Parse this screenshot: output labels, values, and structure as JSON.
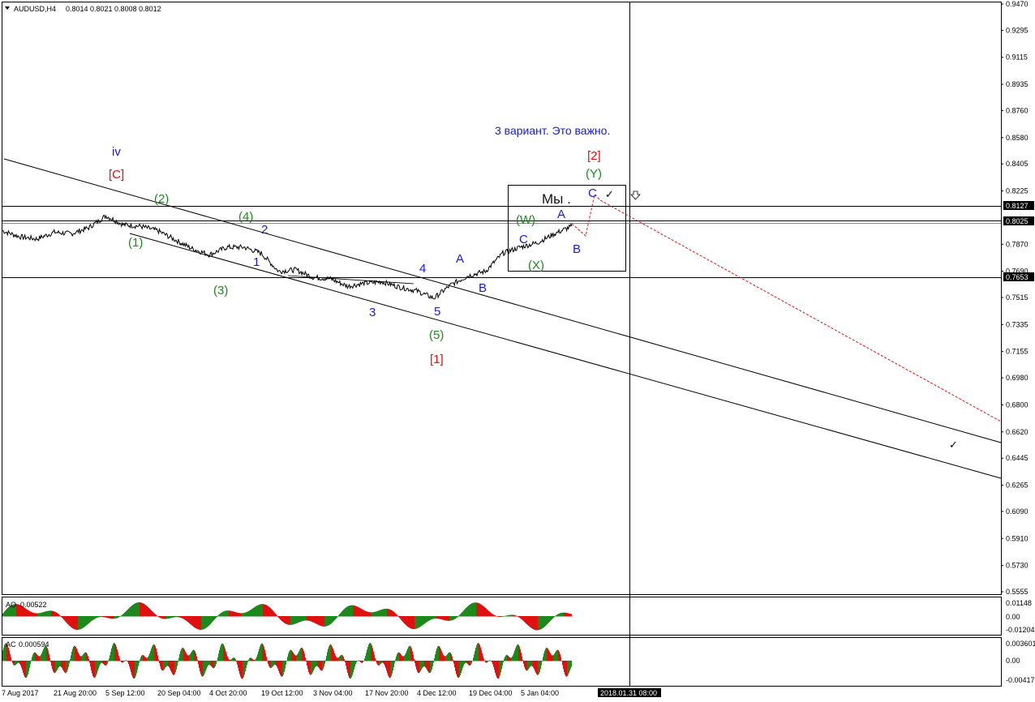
{
  "header": {
    "symbol": "AUDUSD,H4",
    "ohlc": "0.8014 0.8021 0.8008 0.8012",
    "menu_icon": "triangle-down-icon"
  },
  "note": "3 вариант. Это важно.",
  "box_label": "Мы .",
  "colors": {
    "blue": "#1a1ad6",
    "red": "#e01010",
    "green": "#1b8a1b",
    "ao_up": "#1b8a1b",
    "ao_down": "#e01010",
    "forecast": "#e01010"
  },
  "icons": {
    "arrow_marker": "arrow-down-outline-icon",
    "check_marks": "check-mark-icon"
  },
  "price_axis": [
    "0.9470",
    "0.9295",
    "0.9115",
    "0.8935",
    "0.8760",
    "0.8580",
    "0.8405",
    "0.8225",
    "0.8127",
    "0.8025",
    "0.7870",
    "0.7690",
    "0.7653",
    "0.7515",
    "0.7335",
    "0.7155",
    "0.6980",
    "0.6800",
    "0.6620",
    "0.6445",
    "0.6265",
    "0.6090",
    "0.5910",
    "0.5730",
    "0.5555"
  ],
  "highlighted_prices": {
    "current": "0.8025",
    "upper": "0.8127",
    "lower": "0.7653"
  },
  "time_axis": [
    "7 Aug 2017",
    "21 Aug 20:00",
    "5 Sep 12:00",
    "20 Sep 04:00",
    "4 Oct 20:00",
    "19 Oct 12:00",
    "3 Nov 04:00",
    "17 Nov 20:00",
    "4 Dec 12:00",
    "19 Dec 04:00",
    "5 Jan 04:00"
  ],
  "crosshair_time": "2018.01.31 08:00",
  "ao": {
    "label": "AO",
    "value": "0.00522",
    "axis": [
      "0.01148",
      "0.00",
      "-0.01204"
    ]
  },
  "ac": {
    "label": "AC",
    "value": "0.000594",
    "axis": [
      "0.003601",
      "0.00",
      "-0.00417"
    ]
  },
  "chart_data": {
    "type": "line",
    "title": "AUDUSD,H4",
    "x_range": [
      "7 Aug 2017",
      "2018.01.31 08:00"
    ],
    "ylim": [
      0.5555,
      0.947
    ],
    "grid": false,
    "series": [
      {
        "x": [
          "7 Aug 2017",
          "10 Aug",
          "15 Aug",
          "21 Aug 20:00",
          "28 Aug",
          "1 Sep",
          "5 Sep 12:00",
          "8 Sep",
          "14 Sep",
          "20 Sep 04:00",
          "26 Sep",
          "2 Oct",
          "4 Oct 20:00",
          "11 Oct",
          "16 Oct",
          "19 Oct 12:00",
          "24 Oct",
          "30 Oct",
          "3 Nov 04:00",
          "9 Nov",
          "14 Nov",
          "17 Nov 20:00",
          "24 Nov",
          "30 Nov",
          "4 Dec 12:00",
          "8 Dec",
          "13 Dec",
          "19 Dec 04:00",
          "27 Dec",
          "2 Jan",
          "5 Jan 04:00",
          "11 Jan",
          "16 Jan",
          "19 Jan"
        ],
        "y": [
          0.796,
          0.792,
          0.7905,
          0.795,
          0.794,
          0.798,
          0.806,
          0.8,
          0.799,
          0.796,
          0.79,
          0.784,
          0.78,
          0.785,
          0.785,
          0.781,
          0.769,
          0.77,
          0.765,
          0.764,
          0.759,
          0.761,
          0.762,
          0.7585,
          0.756,
          0.751,
          0.76,
          0.766,
          0.769,
          0.781,
          0.785,
          0.788,
          0.794,
          0.799
        ]
      }
    ],
    "horizontal_lines": [
      0.8127,
      0.8025,
      0.7653
    ],
    "wave_labels": [
      {
        "text": "iv",
        "color": "blue"
      },
      {
        "text": "[C]",
        "color": "red"
      },
      {
        "text": "(2)",
        "color": "green"
      },
      {
        "text": "(1)",
        "color": "green"
      },
      {
        "text": "(4)",
        "color": "green"
      },
      {
        "text": "2",
        "color": "blue"
      },
      {
        "text": "1",
        "color": "blue"
      },
      {
        "text": "(3)",
        "color": "green"
      },
      {
        "text": "4",
        "color": "blue"
      },
      {
        "text": "3",
        "color": "blue"
      },
      {
        "text": "5",
        "color": "blue"
      },
      {
        "text": "(5)",
        "color": "green"
      },
      {
        "text": "[1]",
        "color": "red"
      },
      {
        "text": "A",
        "color": "blue"
      },
      {
        "text": "B",
        "color": "blue"
      },
      {
        "text": "(W)",
        "color": "green"
      },
      {
        "text": "C",
        "color": "blue"
      },
      {
        "text": "(X)",
        "color": "green"
      },
      {
        "text": "A",
        "color": "blue"
      },
      {
        "text": "B",
        "color": "blue"
      },
      {
        "text": "C",
        "color": "blue"
      },
      {
        "text": "(Y)",
        "color": "green"
      },
      {
        "text": "[2]",
        "color": "red"
      }
    ]
  }
}
